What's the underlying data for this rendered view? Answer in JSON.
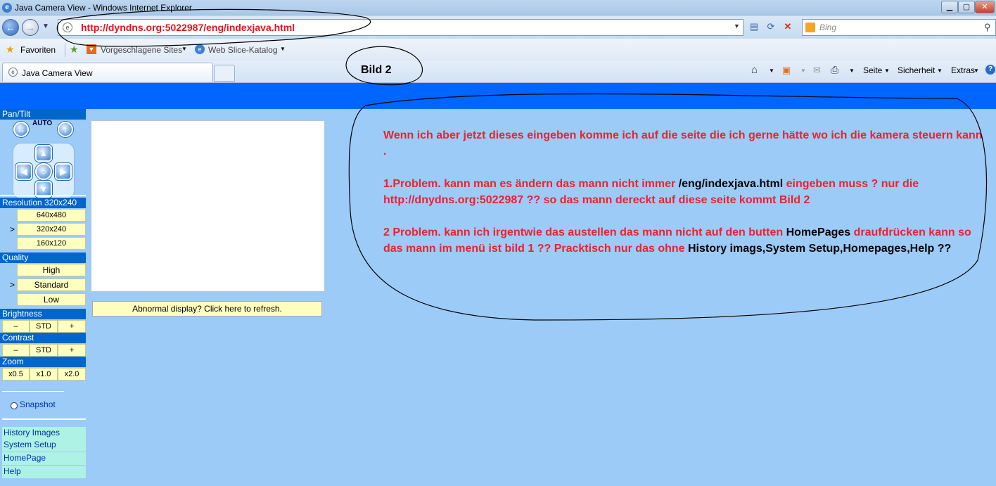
{
  "window": {
    "title": "Java Camera View - Windows Internet Explorer",
    "min": "▁",
    "max": "▢",
    "close": "✕"
  },
  "address": {
    "url": "http://dyndns.org:5022987/eng/indexjava.html"
  },
  "search": {
    "placeholder": "Bing"
  },
  "favorites": {
    "favorites_label": "Favoriten",
    "suggested_label": "Vorgeschlagene Sites",
    "webslice_label": "Web Slice-Katalog"
  },
  "tabs": {
    "active_title": "Java Camera View"
  },
  "annotation": {
    "bild": "Bild 2"
  },
  "command_bar": {
    "page_label": "Seite",
    "safety_label": "Sicherheit",
    "extras_label": "Extras",
    "help": "?"
  },
  "camera_panel": {
    "pantilt": {
      "header": "Pan/Tilt",
      "auto": "AUTO"
    },
    "resolution": {
      "header": "Resolution 320x240",
      "options": [
        "640x480",
        "320x240",
        "160x120"
      ],
      "marker": ">"
    },
    "quality": {
      "header": "Quality",
      "options": [
        "High",
        "Standard",
        "Low"
      ],
      "marker": ">"
    },
    "brightness": {
      "header": "Brightness",
      "minus": "–",
      "std": "STD",
      "plus": "+"
    },
    "contrast": {
      "header": "Contrast",
      "minus": "–",
      "std": "STD",
      "plus": "+"
    },
    "zoom": {
      "header": "Zoom",
      "options": [
        "x0.5",
        "x1.0",
        "x2.0"
      ]
    },
    "snapshot": "Snapshot",
    "links": [
      "History Images",
      "System Setup",
      "HomePage",
      "Help"
    ]
  },
  "refresh_button": "Abnormal display? Click here to refresh.",
  "note": {
    "p1": "Wenn ich aber jetzt dieses eingeben komme ich auf die seite die ich gerne hätte wo ich die kamera steuern kann .",
    "p2a": "1.Problem. kann man es ändern das mann  nicht immer ",
    "p2b": "/eng/indexjava.html",
    "p2c": "  eingeben muss ? nur die",
    "p2d": "   http://dnydns.org:5022987  ?? so das mann dereckt auf diese seite kommt Bild 2",
    "p3a": "2 Problem. kann ich irgentwie das austellen das mann nicht auf den butten ",
    "p3b": "HomePages",
    "p3c": " draufdrücken kann so das mann im menü ist bild 1 ?? Pracktisch nur das ohne ",
    "p3d": "History imags,System Setup,Homepages,Help  ??"
  }
}
